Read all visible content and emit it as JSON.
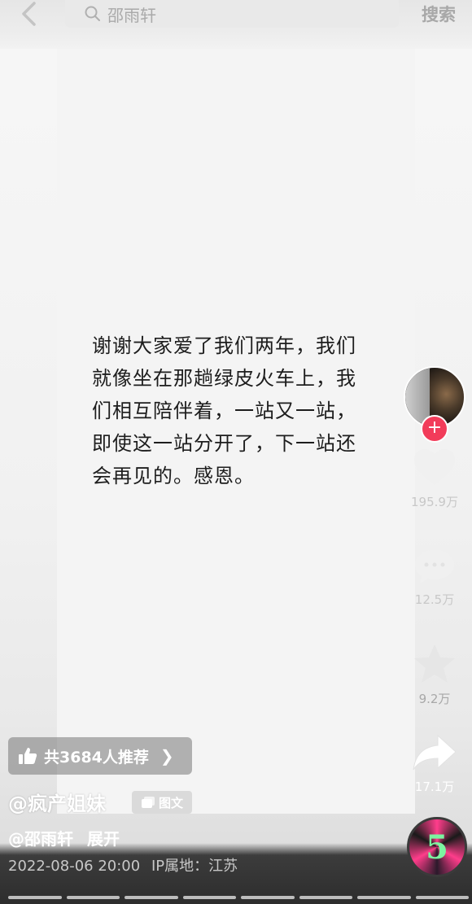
{
  "search": {
    "query": "邵雨轩",
    "button_label": "搜索"
  },
  "post": {
    "lines": [
      "谢谢大家爱了我们两年，我们",
      "就像坐在那趟绿皮火车上，我",
      "们相互陪伴着，一站又一站，",
      "即使这一站分开了，下一站还",
      "会再见的。感恩。"
    ]
  },
  "actions": {
    "like_count": "195.9万",
    "comment_count": "12.5万",
    "favorite_count": "9.2万",
    "share_count": "17.1万"
  },
  "recommend": {
    "label": "共3684人推荐"
  },
  "author": {
    "handle": "@疯产姐妹",
    "tag": "图文"
  },
  "mention": {
    "handle": "@邵雨轩",
    "expand_label": "展开"
  },
  "meta": {
    "timestamp": "2022-08-06 20:00",
    "location": "IP属地：江苏"
  },
  "music": {
    "disc_label": "5"
  },
  "colors": {
    "follow_badge": "#f23c5a",
    "text": "#1d1d1d"
  },
  "icons": [
    "back-arrow-icon",
    "search-icon",
    "plus-icon",
    "heart-icon",
    "comment-icon",
    "star-icon",
    "share-icon",
    "thumbs-up-icon",
    "chevron-right-icon",
    "image-text-icon"
  ]
}
